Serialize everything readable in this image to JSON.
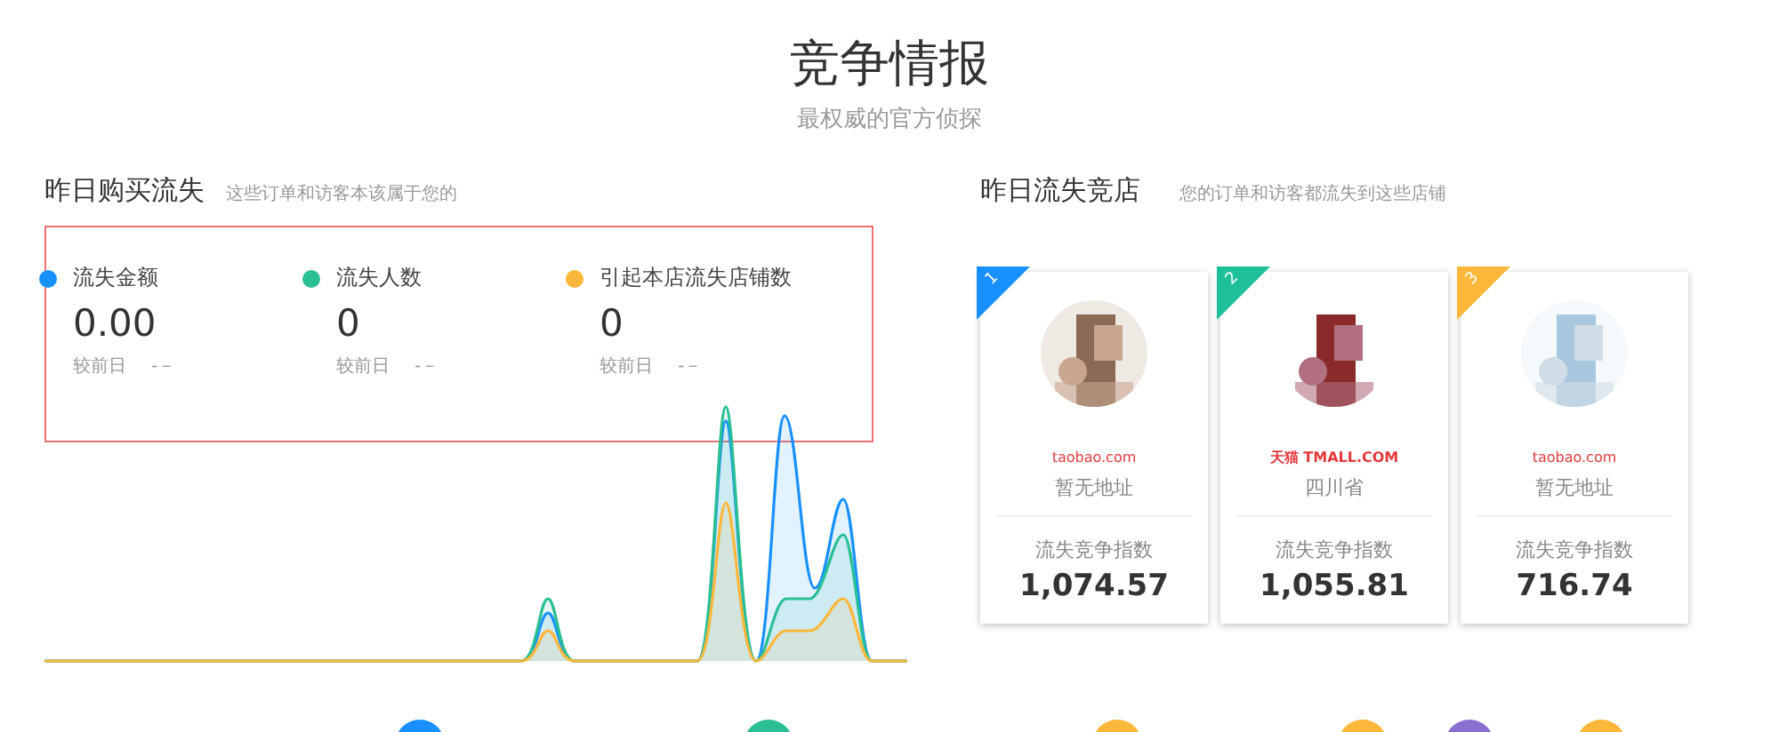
{
  "header": {
    "title": "竞争情报",
    "subtitle": "最权威的官方侦探"
  },
  "lost_purchases": {
    "title": "昨日购买流失",
    "hint": "这些订单和访客本该属于您的",
    "stats": [
      {
        "label": "流失金额",
        "value": "0.00",
        "compare_label": "较前日",
        "compare_value": "-－",
        "color": "#1890ff"
      },
      {
        "label": "流失人数",
        "value": "0",
        "compare_label": "较前日",
        "compare_value": "-－",
        "color": "#2bbf94"
      },
      {
        "label": "引起本店流失店铺数",
        "value": "0",
        "compare_label": "较前日",
        "compare_value": "-－",
        "color": "#fbb73a"
      }
    ]
  },
  "lost_to_stores": {
    "title": "昨日流失竞店",
    "hint": "您的订单和访客都流失到这些店铺",
    "stores": [
      {
        "rank": "1",
        "color": "#1890ff",
        "kind": "taobao",
        "logo": "taobao.com",
        "address": "暂无地址",
        "index_label": "流失竞争指数",
        "index_value": "1,074.57"
      },
      {
        "rank": "2",
        "color": "#1ec09a",
        "kind": "tmall",
        "logo": "天猫 TMALL.COM",
        "address": "四川省",
        "index_label": "流失竞争指数",
        "index_value": "1,055.81"
      },
      {
        "rank": "3",
        "color": "#fbb73a",
        "kind": "taobao",
        "logo": "taobao.com",
        "address": "暂无地址",
        "index_label": "流失竞争指数",
        "index_value": "716.74"
      }
    ]
  },
  "bottom_icons": [
    {
      "color": "#1890ff"
    },
    {
      "color": "#2bbf94"
    },
    {
      "color": "#fbb73a"
    },
    {
      "color": "#fbb73a"
    },
    {
      "color": "#8a6fd1"
    },
    {
      "color": "#fbb73a"
    }
  ]
}
